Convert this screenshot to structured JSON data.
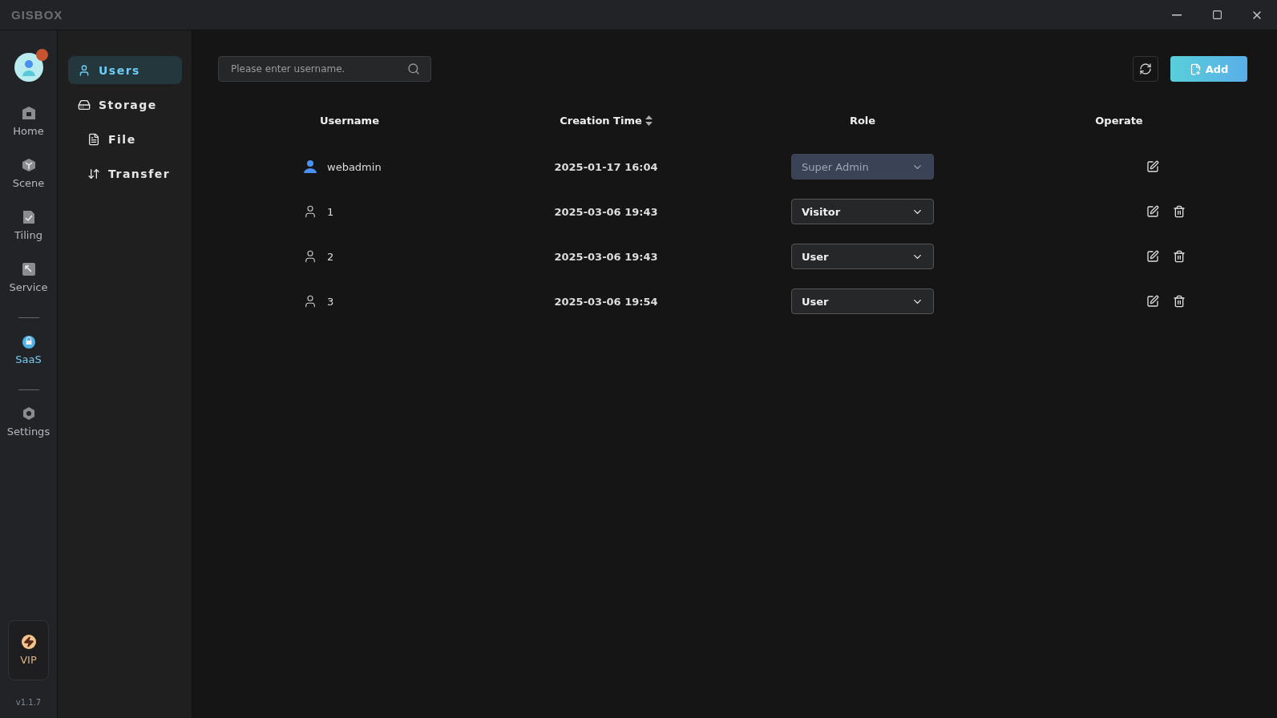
{
  "app": {
    "logo": "GISBOX"
  },
  "rail": {
    "items": [
      {
        "label": "Home",
        "kind": "home",
        "selected": false,
        "divider_before": false
      },
      {
        "label": "Scene",
        "kind": "scene",
        "selected": false,
        "divider_before": false
      },
      {
        "label": "Tiling",
        "kind": "tiling",
        "selected": false,
        "divider_before": false
      },
      {
        "label": "Service",
        "kind": "service",
        "selected": false,
        "divider_before": false
      },
      {
        "label": "SaaS",
        "kind": "saas",
        "selected": true,
        "divider_before": true
      },
      {
        "label": "Settings",
        "kind": "settings",
        "selected": false,
        "divider_before": true
      }
    ],
    "vip": "VIP",
    "version": "v1.1.7"
  },
  "submenu": {
    "items": [
      {
        "label": "Users",
        "kind": "user",
        "selected": true
      },
      {
        "label": "Storage",
        "kind": "storage",
        "selected": false,
        "children": [
          {
            "label": "File",
            "kind": "file",
            "selected": false
          },
          {
            "label": "Transfer",
            "kind": "transfer",
            "selected": false
          }
        ]
      }
    ]
  },
  "search": {
    "placeholder": "Please enter username."
  },
  "add_button": "Add",
  "table": {
    "columns": [
      "Username",
      "Creation Time",
      "Role",
      "Operate"
    ],
    "rows": [
      {
        "kind": "admin",
        "username": "webadmin",
        "created": "2025-01-17 16:04",
        "role": "Super Admin",
        "role_disabled": true,
        "deletable": false
      },
      {
        "kind": "user",
        "username": "1",
        "created": "2025-03-06 19:43",
        "role": "Visitor",
        "role_disabled": false,
        "deletable": true
      },
      {
        "kind": "user",
        "username": "2",
        "created": "2025-03-06 19:43",
        "role": "User",
        "role_disabled": false,
        "deletable": true
      },
      {
        "kind": "user",
        "username": "3",
        "created": "2025-03-06 19:54",
        "role": "User",
        "role_disabled": false,
        "deletable": true
      }
    ]
  }
}
